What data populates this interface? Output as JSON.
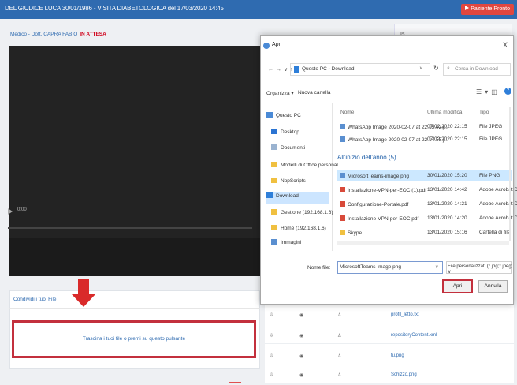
{
  "header": {
    "title": "DEL GIUDICE LUCA 30/01/1986 - VISITA DIABETOLOGICA del 17/03/2020 14:45",
    "patient_ready": "Paziente Pronto"
  },
  "visit": {
    "doctor": "Medico - Dott. CAPRA FABIO",
    "status": "IN ATTESA",
    "video_time": "0:00",
    "side_label": "Is"
  },
  "share": {
    "title": "Condividi i tuoi File",
    "drop_label": "Trascina i tuoi file o premi su questo pulsante"
  },
  "files": [
    {
      "name": "profil_letto.txt"
    },
    {
      "name": "repositoryContent.xml"
    },
    {
      "name": "tu.png"
    },
    {
      "name": "Schizzo.png"
    }
  ],
  "dialog": {
    "title": "Apri",
    "close": "X",
    "address": "Questo PC  ›  Download",
    "search_placeholder": "Cerca in Download",
    "organize": "Organizza ▾",
    "new_folder": "Nuova cartella",
    "nav": [
      {
        "label": "Questo PC",
        "color": "#4a8ad6"
      },
      {
        "label": "Desktop",
        "color": "#2b74d2"
      },
      {
        "label": "Documenti",
        "color": "#9ab3d0"
      },
      {
        "label": "Modelli di Office personal",
        "color": "#f0c040"
      },
      {
        "label": "NppScripts",
        "color": "#f0c040"
      },
      {
        "label": "Download",
        "color": "#2f7fd9"
      },
      {
        "label": "Gestione (192.168.1.6)",
        "color": "#f0c040"
      },
      {
        "label": "Home (192.168.1.6)",
        "color": "#f0c040"
      },
      {
        "label": "Immagini",
        "color": "#5a8fd0"
      }
    ],
    "columns": {
      "name": "Nome",
      "modified": "Ultima modifica",
      "type": "Tipo"
    },
    "group_earlier": "",
    "group_year": "All'inizio dell'anno (5)",
    "recent_files": [
      {
        "name": "WhatsApp Image 2020-02-07 at 22.15.02.j...",
        "date": "07/02/2020 22:15",
        "type": "File JPEG"
      },
      {
        "name": "WhatsApp Image 2020-02-07 at 22.14.55.j...",
        "date": "07/02/2020 22:15",
        "type": "File JPEG"
      }
    ],
    "year_files": [
      {
        "name": "MicrosoftTeams-image.png",
        "date": "30/01/2020 15:20",
        "type": "File PNG"
      },
      {
        "name": "Installazione-VPN-per-EOC (1).pdf",
        "date": "13/01/2020 14:42",
        "type": "Adobe Acrobat D."
      },
      {
        "name": "Configurazione-Portale.pdf",
        "date": "13/01/2020 14:21",
        "type": "Adobe Acrobat D."
      },
      {
        "name": "Installazione-VPN-per-EOC.pdf",
        "date": "13/01/2020 14:20",
        "type": "Adobe Acrobat D."
      },
      {
        "name": "Skype",
        "date": "13/01/2020 15:16",
        "type": "Cartella di file"
      }
    ],
    "filename_label": "Nome file:",
    "filename_value": "MicrosoftTeams-image.png",
    "filetype_value": "File personalizzati (*.jpg;*.jpeg; ∨",
    "open_label": "Apri",
    "cancel_label": "Annulla"
  }
}
